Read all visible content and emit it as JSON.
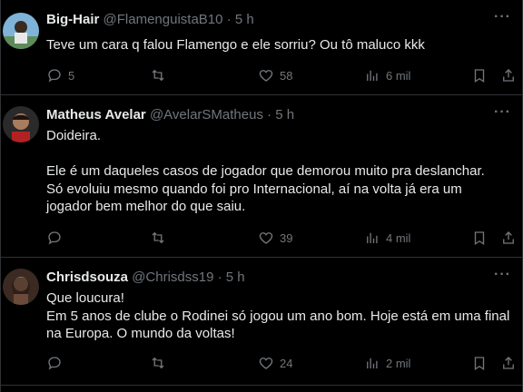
{
  "tweets": [
    {
      "name": "Big-Hair",
      "handle": "@FlamenguistaB10",
      "sep": "·",
      "time": "5 h",
      "more": "···",
      "lines": [
        "Teve um cara q falou Flamengo e ele sorriu? Ou tô maluco kkk"
      ],
      "replies": "5",
      "retweets": "",
      "likes": "58",
      "views": "6 mil"
    },
    {
      "name": "Matheus Avelar",
      "handle": "@AvelarSMatheus",
      "sep": "·",
      "time": "5 h",
      "more": "···",
      "lines": [
        "Doideira.",
        "",
        "Ele é um daqueles casos de jogador que demorou muito pra deslanchar.",
        "Só evoluiu mesmo quando foi pro Internacional, aí na volta já era um",
        "jogador bem melhor do que saiu."
      ],
      "replies": "",
      "retweets": "",
      "likes": "39",
      "views": "4 mil"
    },
    {
      "name": "Chrisdsouza",
      "handle": "@Chrisdss19",
      "sep": "·",
      "time": "5 h",
      "more": "···",
      "lines": [
        "Que loucura!",
        "Em 5 anos de clube o Rodinei só jogou um ano bom. Hoje está em uma final",
        "na Europa. O mundo da voltas!"
      ],
      "replies": "",
      "retweets": "",
      "likes": "24",
      "views": "2 mil"
    }
  ]
}
